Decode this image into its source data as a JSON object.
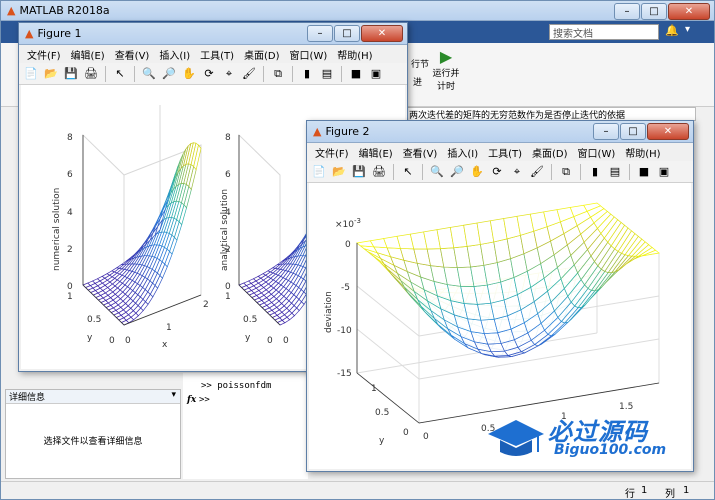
{
  "main": {
    "title": "MATLAB R2018a",
    "search_placeholder": "搜索文档",
    "ribbon_btn1": "行节",
    "ribbon_btn2": "进",
    "ribbon_run_time": "运行并\n计时",
    "ribbon_run_time_l1": "运行并",
    "ribbon_run_time_l2": "计时",
    "comment_line": "两次迭代差的矩阵的无穷范数作为是否停止迭代的依据",
    "details_header": "详细信息",
    "details_text": "选择文件以查看详细信息",
    "cmd_line1": ">> poissonfdm",
    "cmd_prompt": ">>",
    "fx": "fx",
    "status_row": "行",
    "status_row_val": "1",
    "status_col": "列",
    "status_col_val": "1"
  },
  "figure1": {
    "title": "Figure 1",
    "menu": [
      "文件(F)",
      "编辑(E)",
      "查看(V)",
      "插入(I)",
      "工具(T)",
      "桌面(D)",
      "窗口(W)",
      "帮助(H)"
    ],
    "left_zlabel": "numerical solution",
    "right_zlabel": "analytical solution",
    "z_ticks": [
      "8",
      "6",
      "4",
      "2",
      "0"
    ],
    "y_ticks": [
      "1",
      "0.5",
      "0"
    ],
    "x_ticks": [
      "0",
      "1",
      "2"
    ],
    "ylabel": "y",
    "xlabel": "x",
    "right_x_ticks": [
      "0"
    ]
  },
  "figure2": {
    "title": "Figure 2",
    "menu": [
      "文件(F)",
      "编辑(E)",
      "查看(V)",
      "插入(I)",
      "工具(T)",
      "桌面(D)",
      "窗口(W)",
      "帮助(H)"
    ],
    "exponent": "×10",
    "exponent_power": "-3",
    "zlabel": "deviation",
    "z_ticks": [
      "0",
      "-5",
      "-10",
      "-15"
    ],
    "y_ticks": [
      "1",
      "0.5",
      "0"
    ],
    "x_ticks": [
      "1.5",
      "1",
      "0.5",
      "0"
    ],
    "ylabel": "y"
  },
  "watermark": {
    "brand_cn": "必过源码",
    "brand_url": "Biguo100.com"
  },
  "colors": {
    "parula_low": "#3e26a8",
    "parula_mid": "#2eb7a3",
    "parula_high": "#f9fb0e",
    "titlebar": "#c4d8ef"
  }
}
